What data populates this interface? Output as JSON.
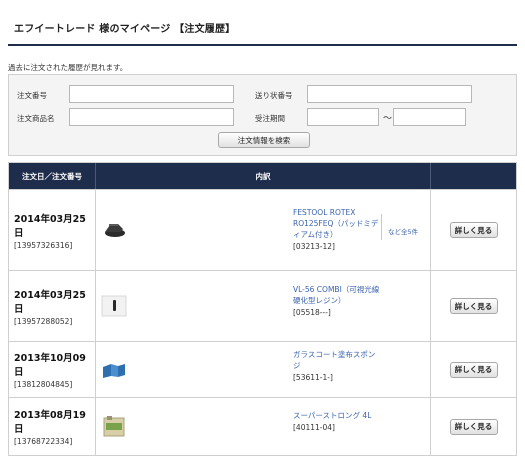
{
  "header": {
    "title": "エフイートレード 様のマイページ 【注文履歴】"
  },
  "intro": "過去に注文された履歴が見れます。",
  "search": {
    "order_number_label": "注文番号",
    "tracking_label": "送り状番号",
    "product_name_label": "注文商品名",
    "period_label": "受注期間",
    "order_number_value": "",
    "tracking_value": "",
    "product_name_value": "",
    "period_from": "",
    "period_to": "",
    "tilde": "～",
    "button": "注文情報を検索"
  },
  "table": {
    "headers": [
      "注文日／注文番号",
      "内訳",
      ""
    ],
    "rows": [
      {
        "date": "2014年03月25日",
        "order_no": "[13957326316]",
        "product": "FESTOOL ROTEX RO125FEQ（パッドミディアム付き）",
        "code": "[03213-12]",
        "more": "など全5件",
        "detail": "詳しく見る",
        "thumb": "sander"
      },
      {
        "date": "2014年03月25日",
        "order_no": "[13957288052]",
        "product": "VL-56 COMBI（可視光線硬化型レジン）",
        "code": "[05518---]",
        "more": "",
        "detail": "詳しく見る",
        "thumb": "resin"
      },
      {
        "date": "2013年10月09日",
        "order_no": "[13812804845]",
        "product": "ガラスコート塗布スポンジ",
        "code": "[53611-1-]",
        "more": "",
        "detail": "詳しく見る",
        "thumb": "sponge"
      },
      {
        "date": "2013年08月19日",
        "order_no": "[13768722334]",
        "product": "スーパーストロング 4L",
        "code": "[40111-04]",
        "more": "",
        "detail": "詳しく見る",
        "thumb": "can"
      }
    ]
  }
}
